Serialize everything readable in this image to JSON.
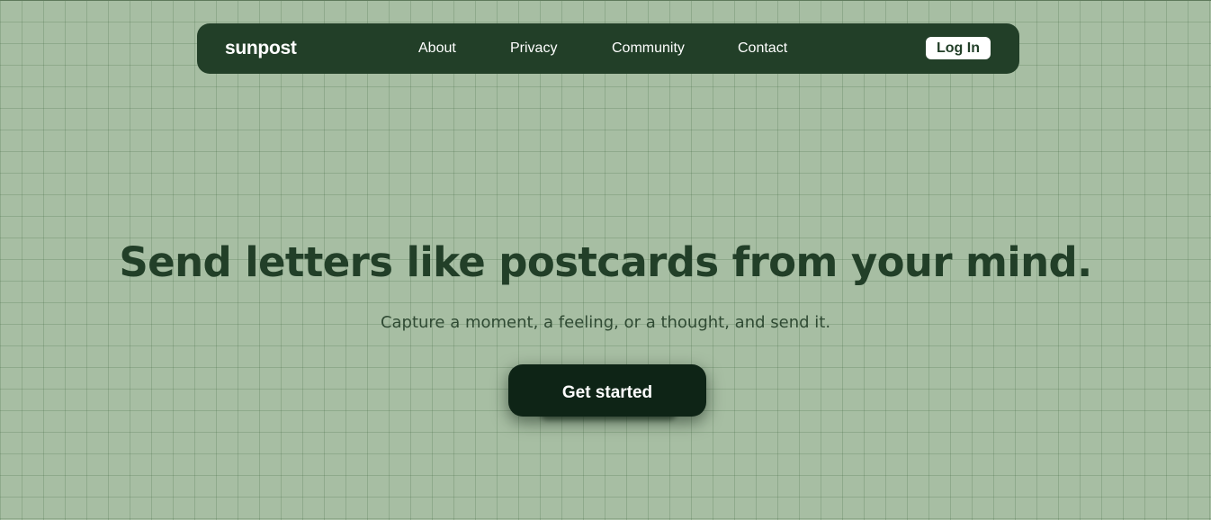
{
  "nav": {
    "brand": "sunpost",
    "links": [
      "About",
      "Privacy",
      "Community",
      "Contact"
    ],
    "login_label": "Log In"
  },
  "hero": {
    "title": "Send letters like postcards from your mind.",
    "subtitle": "Capture a moment, a feeling, or a thought, and send it.",
    "cta_label": "Get started"
  },
  "colors": {
    "background": "#a7bea3",
    "navbar": "#223f28",
    "cta": "#0e2416",
    "heading": "#223f28"
  }
}
